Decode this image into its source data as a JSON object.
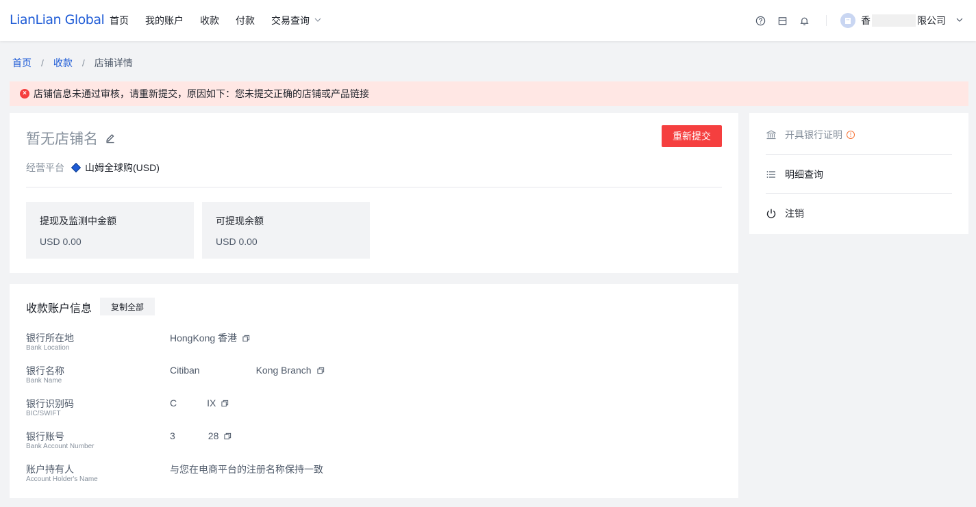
{
  "header": {
    "logo": "LianLian Global",
    "nav": [
      "首页",
      "我的账户",
      "收款",
      "付款",
      "交易查询"
    ],
    "company_prefix": "香",
    "company_suffix": "限公司"
  },
  "breadcrumb": [
    "首页",
    "收款",
    "店铺详情"
  ],
  "alert": "店铺信息未通过审核，请重新提交，原因如下：您未提交正确的店铺或产品链接",
  "store": {
    "name": "暂无店铺名",
    "resubmit_label": "重新提交",
    "platform_label": "经营平台",
    "platform_value": "山姆全球购(USD)",
    "stats": [
      {
        "title": "提现及监测中金额",
        "value": "USD 0.00"
      },
      {
        "title": "可提现余额",
        "value": "USD 0.00"
      }
    ]
  },
  "side_menu": [
    {
      "label": "开具银行证明",
      "icon": "bank-icon"
    },
    {
      "label": "明细查询",
      "icon": "list-icon"
    },
    {
      "label": "注销",
      "icon": "power-icon"
    }
  ],
  "account": {
    "title": "收款账户信息",
    "copy_all_label": "复制全部",
    "rows": [
      {
        "label": "银行所在地",
        "label_en": "Bank Location",
        "value_a": "HongKong 香港",
        "value_b": ""
      },
      {
        "label": "银行名称",
        "label_en": "Bank Name",
        "value_a": "Citiban",
        "value_b": "Kong Branch"
      },
      {
        "label": "银行识别码",
        "label_en": "BIC/SWIFT",
        "value_a": "C",
        "value_b": "IX"
      },
      {
        "label": "银行账号",
        "label_en": "Bank Account Number",
        "value_a": "3",
        "value_b": "28"
      },
      {
        "label": "账户持有人",
        "label_en": "Account Holder's Name",
        "value_a": "与您在电商平台的注册名称保持一致",
        "value_b": ""
      }
    ]
  },
  "colors": {
    "brand": "#1e5bd6",
    "danger": "#f53f3f",
    "alert_bg": "#ffe7e4",
    "warn": "#f77234"
  }
}
